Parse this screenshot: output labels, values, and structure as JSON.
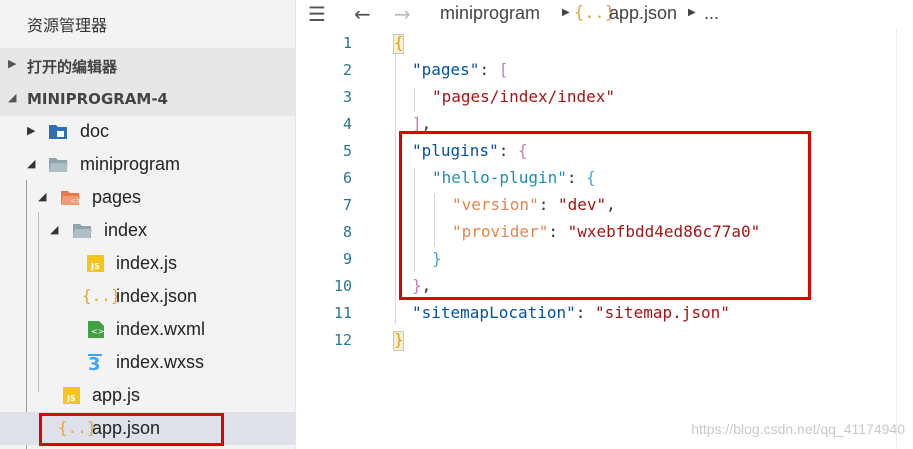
{
  "sidebar": {
    "title": "资源管理器",
    "sections": [
      {
        "label": "打开的编辑器",
        "expanded": false
      },
      {
        "label": "MINIPROGRAM-4",
        "expanded": true
      }
    ],
    "tree": [
      {
        "name": "doc",
        "type": "folder-blue"
      },
      {
        "name": "miniprogram",
        "type": "folder-open"
      },
      {
        "name": "pages",
        "type": "folder-pages"
      },
      {
        "name": "index",
        "type": "folder-open"
      },
      {
        "name": "index.js",
        "type": "js-icon"
      },
      {
        "name": "index.json",
        "type": "json-icon"
      },
      {
        "name": "index.wxml",
        "type": "wxml-icon"
      },
      {
        "name": "index.wxss",
        "type": "wxss-icon"
      },
      {
        "name": "app.js",
        "type": "js-icon"
      },
      {
        "name": "app.json",
        "type": "json-icon",
        "selected": true
      }
    ]
  },
  "editor": {
    "breadcrumb": [
      "miniprogram",
      "app.json",
      "..."
    ],
    "json_icon_glyph": "{..}",
    "line_numbers": [
      "1",
      "2",
      "3",
      "4",
      "5",
      "6",
      "7",
      "8",
      "9",
      "10",
      "11",
      "12"
    ],
    "code": {
      "l1": "{",
      "l2_key": "\"pages\"",
      "l2_rest": ": ",
      "l2_br": "[",
      "l3": "\"pages/index/index\"",
      "l4_br": "]",
      "l4_rest": ",",
      "l5_key": "\"plugins\"",
      "l5_rest": ": ",
      "l5_br": "{",
      "l6_key": "\"hello-plugin\"",
      "l6_rest": ": ",
      "l6_br": "{",
      "l7_key": "\"version\"",
      "l7_rest": ": ",
      "l7_val": "\"dev\"",
      "l7_end": ",",
      "l8_key": "\"provider\"",
      "l8_rest": ": ",
      "l8_val": "\"wxebfbdd4ed86c77a0\"",
      "l9_br": "}",
      "l10_br": "}",
      "l10_rest": ",",
      "l11_key": "\"sitemapLocation\"",
      "l11_rest": ": ",
      "l11_val": "\"sitemap.json\"",
      "l12": "}"
    }
  },
  "watermark": "https://blog.csdn.net/qq_41174940",
  "colors": {
    "highlight": "#e00000",
    "key": "#0451a5",
    "string": "#a31515",
    "line_number": "#237893"
  }
}
